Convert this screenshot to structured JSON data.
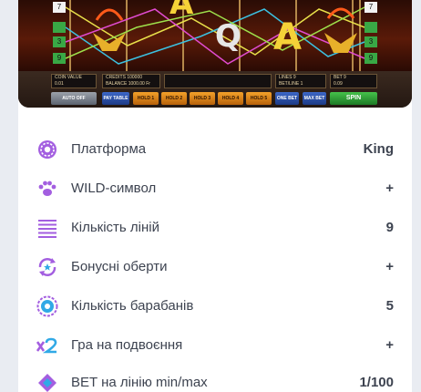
{
  "game_panel": {
    "line_markers_left": [
      "7",
      "",
      "3",
      "9"
    ],
    "line_markers_right": [
      "7",
      "",
      "3",
      "9"
    ],
    "symbols": [
      "A",
      "Q",
      "A"
    ],
    "coin_value_label": "COIN VALUE",
    "coin_value": "0.01",
    "credits_label": "CREDITS",
    "credits_value": "100000",
    "balance_label": "BALANCE",
    "balance_value": "1000.00 Fr",
    "lines_label": "LINES",
    "lines_value": "9",
    "bet_line_label": "BET/LINE",
    "bet_line_value": "1",
    "bet_label": "BET",
    "bet_value": "9",
    "bet_sub_value": "0.09",
    "auto_off": "AUTO OFF",
    "pay_table": "PAY TABLE",
    "hold_1": "HOLD 1",
    "hold_2": "HOLD 2",
    "hold_3": "HOLD 3",
    "hold_4": "HOLD 4",
    "hold_5": "HOLD 5",
    "one_bet": "ONE BET",
    "max_bet": "MAX BET",
    "spin": "SPIN"
  },
  "specs": [
    {
      "icon": "gear-icon",
      "label": "Платформа",
      "value": "King"
    },
    {
      "icon": "paw-icon",
      "label": "WILD-символ",
      "value": "+"
    },
    {
      "icon": "lines-icon",
      "label": "Кількість ліній",
      "value": "9"
    },
    {
      "icon": "bonus-spin-icon",
      "label": "Бонусні оберти",
      "value": "+"
    },
    {
      "icon": "reel-icon",
      "label": "Кількість барабанів",
      "value": "5"
    },
    {
      "icon": "x2-icon",
      "label": "Гра на подвоєння",
      "value": "+"
    },
    {
      "icon": "bet-icon",
      "label": "BET на лінію min/max",
      "value": "1/100"
    }
  ],
  "colors": {
    "accent": "#a35ee0",
    "accent_blue": "#31a9e6",
    "page_bg": "#e9ecf2"
  }
}
